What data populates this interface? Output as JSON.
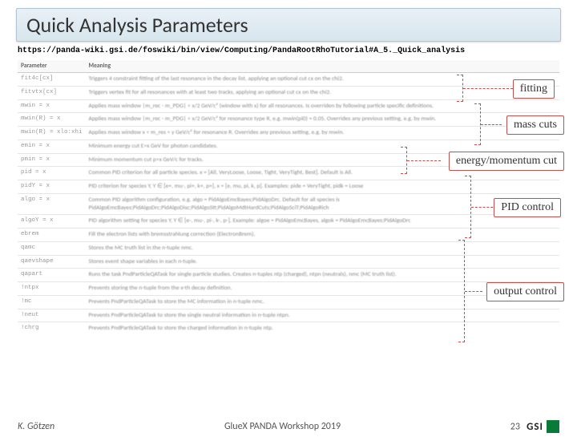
{
  "title": "Quick Analysis Parameters",
  "url": "https://panda-wiki.gsi.de/foswiki/bin/view/Computing/PandaRootRhoTutorial#A_5._Quick_analysis",
  "table": {
    "headers": [
      "Parameter",
      "Meaning"
    ],
    "rows": [
      {
        "param": "fit4c[cx]",
        "meaning": "Triggers 4 constraint fitting of the last resonance in the decay list, applying an optional cut cx on the chi2."
      },
      {
        "param": "fitvtx[cx]",
        "meaning": "Triggers vertex fit for all resonances with at least two tracks, applying an optional cut cx on the chi2."
      },
      {
        "param": "mwin = x",
        "meaning": "Applies mass window |m_rec - m_PDG| < x/2 GeV/c² (window with x) for all resonances. Is overriden by following particle specific definitions."
      },
      {
        "param": "mwin(R) = x",
        "meaning": "Applies mass window |m_rec - m_PDG| < x/2 GeV/c² for resonance type R, e.g. mwin(pi0) = 0.05. Overrides any previous setting, e.g. by mwin."
      },
      {
        "param": "mwin(R) = xlo:xhi",
        "meaning": "Applies mass window x < m_res < y GeV/c² for resonance R. Overrides any previous setting, e.g. by mwin."
      },
      {
        "param": "emin = x",
        "meaning": "Minimum energy cut E>x GeV for photon candidates."
      },
      {
        "param": "pmin = x",
        "meaning": "Minimum momentum cut p>x GeV/c for tracks."
      },
      {
        "param": "pid = x",
        "meaning": "Common PID criterion for all particle species. x = [All, VeryLoose, Loose, Tight, VeryTight, Best]. Default is All."
      },
      {
        "param": "pidY = x",
        "meaning": "PID criterion for species Y, Y ∈ [e+, mu-, pi+, k+, p+], x = [e, mu, pi, k, p]. Examples: pide = VeryTight, pidk = Loose"
      },
      {
        "param": "algo = x",
        "meaning": "Common PID algorithm configuration, e.g. algo = PidAlgoEmcBayes;PidAlgoDrc. Default for all species is PidAlgoEmcBayes;PidAlgoDrc;PidAlgoDisc;PidAlgoStt;PidAlgoMdtHardCuts;PidAlgoSciT;PidAlgoRich"
      },
      {
        "param": "algoY = x",
        "meaning": "PID algorithm setting for species Y, Y ∈ [e-, mu-, pi-, k-, p-]. Example: algoe = PidAlgoEmcBayes, algok = PidAlgoEmcBayes;PidAlgoDrc"
      },
      {
        "param": "ebrem",
        "meaning": "Fill the electron lists with bremsstrahlung correction (ElectronBrem)."
      },
      {
        "param": "qamc",
        "meaning": "Stores the MC truth list in the n-tuple nmc."
      },
      {
        "param": "qaevshape",
        "meaning": "Stores event shape variables in each n-tuple."
      },
      {
        "param": "qapart",
        "meaning": "Runs the task PndParticleQATask for single particle studies. Creates n-tuples ntp (charged), ntpn (neutrals), nmc (MC truth list)."
      },
      {
        "param": "!ntpx",
        "meaning": "Prevents storing the n-tuple from the x-th decay definition."
      },
      {
        "param": "!mc",
        "meaning": "Prevents PndParticleQATask to store the MC information in n-tuple nmc."
      },
      {
        "param": "!neut",
        "meaning": "Prevents PndParticleQATask to store the single neutral information in n-tuple ntpn."
      },
      {
        "param": "!chrg",
        "meaning": "Prevents PndParticleQATask to store the charged information in n-tuple ntp."
      }
    ]
  },
  "callouts": {
    "fitting": "fitting",
    "mass_cuts": "mass cuts",
    "energy": "energy/momentum cut",
    "pid": "PID control",
    "output": "output  control"
  },
  "footer": {
    "author": "K. Götzen",
    "event": "GlueX PANDA Workshop 2019",
    "page": "23",
    "logo": "GSI"
  }
}
